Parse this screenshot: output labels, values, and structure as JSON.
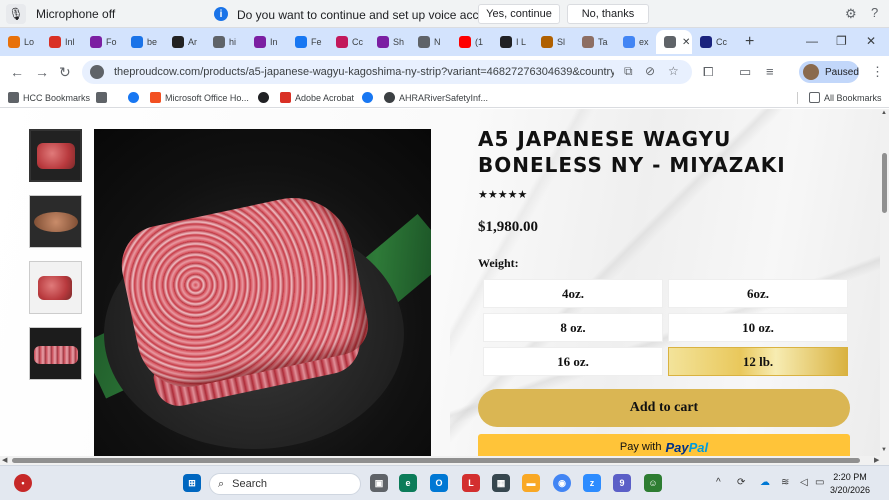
{
  "voice_bar": {
    "mic_label": "Microphone off",
    "prompt": "Do you want to continue and set up voice access?",
    "yes_label": "Yes, continue",
    "no_label": "No, thanks"
  },
  "tabs": [
    {
      "label": "Lo",
      "icon": "hcc-icon",
      "color": "#e8710a"
    },
    {
      "label": "Inl",
      "icon": "gmail-icon",
      "color": "#d93025"
    },
    {
      "label": "Fo",
      "icon": "butterfly-icon",
      "color": "#7b1fa2"
    },
    {
      "label": "be",
      "icon": "search-icon",
      "color": "#1a73e8"
    },
    {
      "label": "Ar",
      "icon": "amazon-icon",
      "color": "#222222"
    },
    {
      "label": "hi",
      "icon": "google-lens-icon",
      "color": "#5f6368"
    },
    {
      "label": "In",
      "icon": "butterfly-icon",
      "color": "#7b1fa2"
    },
    {
      "label": "Fe",
      "icon": "facebook-icon",
      "color": "#1877f2"
    },
    {
      "label": "Cc",
      "icon": "butterfly-icon",
      "color": "#c2185b"
    },
    {
      "label": "Sh",
      "icon": "butterfly-icon",
      "color": "#7b1fa2"
    },
    {
      "label": "N",
      "icon": "globe-icon",
      "color": "#5f6368"
    },
    {
      "label": "(1",
      "icon": "youtube-icon",
      "color": "#ff0000"
    },
    {
      "label": "I L",
      "icon": "app-icon",
      "color": "#202124"
    },
    {
      "label": "Sl",
      "icon": "app-icon",
      "color": "#b06000"
    },
    {
      "label": "Ta",
      "icon": "app-icon",
      "color": "#8d6e63"
    },
    {
      "label": "ex",
      "icon": "google-icon",
      "color": "#4285f4"
    },
    {
      "label": "",
      "icon": "active-tab-icon",
      "color": "#5f6368"
    },
    {
      "label": "Cc",
      "icon": "app-icon",
      "color": "#1a237e"
    }
  ],
  "address": {
    "url": "theproudcow.com/products/a5-japanese-wagyu-kagoshima-ny-strip?variant=46827276304639&country=US&curre...",
    "profile_label": "Paused"
  },
  "bookmarks": [
    {
      "label": "HCC Bookmarks",
      "icon": "folder-icon",
      "color": "#5f6368"
    },
    {
      "label": "",
      "icon": "apps-grid-icon",
      "color": "#5f6368"
    },
    {
      "label": "",
      "icon": "facebook-icon",
      "color": "#1877f2"
    },
    {
      "label": "Microsoft Office Ho...",
      "icon": "microsoft-icon",
      "color": "#f25022"
    },
    {
      "label": "",
      "icon": "globe-icon",
      "color": "#202124"
    },
    {
      "label": "Adobe Acrobat",
      "icon": "adobe-acrobat-icon",
      "color": "#d93025"
    },
    {
      "label": "",
      "icon": "facebook-icon",
      "color": "#1877f2"
    },
    {
      "label": "AHRARiverSafetyInf...",
      "icon": "app-icon",
      "color": "#3c4043"
    }
  ],
  "all_bookmarks_label": "All Bookmarks",
  "product": {
    "title": "A5 JAPANESE WAGYU BONELESS NY - MIYAZAKI",
    "stars": "★★★★★",
    "rating": 5,
    "price": "$1,980.00",
    "weight_label": "Weight:",
    "weights": [
      "4oz.",
      "6oz.",
      "8 oz.",
      "10 oz.",
      "16 oz.",
      "12 lb."
    ],
    "selected_weight": "12 lb.",
    "add_to_cart": "Add to cart",
    "paypal_prefix": "Pay with",
    "paypal_brand_1": "Pay",
    "paypal_brand_2": "Pal"
  },
  "taskbar": {
    "search_label": "Search",
    "time": "2:20 PM",
    "date": "3/20/2026",
    "notification_count": "9"
  }
}
